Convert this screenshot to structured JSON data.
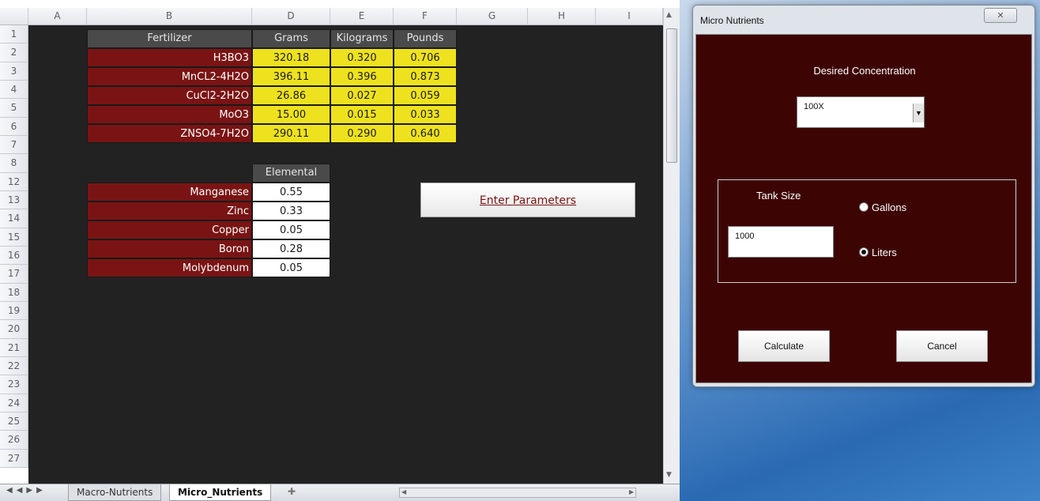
{
  "spreadsheet": {
    "columns": [
      "A",
      "B",
      "D",
      "E",
      "F",
      "G",
      "H",
      "I"
    ],
    "rows": [
      "1",
      "2",
      "3",
      "4",
      "5",
      "6",
      "7",
      "8",
      "12",
      "13",
      "14",
      "15",
      "16",
      "17",
      "18",
      "19",
      "20",
      "21",
      "22",
      "23",
      "24",
      "25",
      "26",
      "27"
    ],
    "table1": {
      "headers": {
        "fertilizer": "Fertilizer",
        "grams": "Grams",
        "kilograms": "Kilograms",
        "pounds": "Pounds"
      },
      "rows": [
        {
          "name": "H3BO3",
          "grams": "320.18",
          "kg": "0.320",
          "lb": "0.706"
        },
        {
          "name": "MnCL2-4H2O",
          "grams": "396.11",
          "kg": "0.396",
          "lb": "0.873"
        },
        {
          "name": "CuCl2-2H2O",
          "grams": "26.86",
          "kg": "0.027",
          "lb": "0.059"
        },
        {
          "name": "MoO3",
          "grams": "15.00",
          "kg": "0.015",
          "lb": "0.033"
        },
        {
          "name": "ZNSO4-7H2O",
          "grams": "290.11",
          "kg": "0.290",
          "lb": "0.640"
        }
      ]
    },
    "table2": {
      "header": "Elemental",
      "rows": [
        {
          "name": "Manganese",
          "value": "0.55"
        },
        {
          "name": "Zinc",
          "value": "0.33"
        },
        {
          "name": "Copper",
          "value": "0.05"
        },
        {
          "name": "Boron",
          "value": "0.28"
        },
        {
          "name": "Molybdenum",
          "value": "0.05"
        }
      ]
    },
    "enter_button": "Enter Parameters",
    "tabs": {
      "macro": "Macro-Nutrients",
      "micro": "Micro_Nutrients"
    }
  },
  "dialog": {
    "title": "Micro Nutrients",
    "close_glyph": "✕",
    "concentration_label": "Desired Concentration",
    "concentration_value": "100X",
    "tank_size_label": "Tank Size",
    "tank_size_value": "1000",
    "units": {
      "gallons": "Gallons",
      "liters": "Liters",
      "selected": "Liters"
    },
    "calculate_label": "Calculate",
    "cancel_label": "Cancel"
  },
  "colors": {
    "sheet_background": "#222222",
    "fertilizer_fill": "#7a1414",
    "value_fill": "#eee21e",
    "dialog_body": "#3d0404"
  }
}
